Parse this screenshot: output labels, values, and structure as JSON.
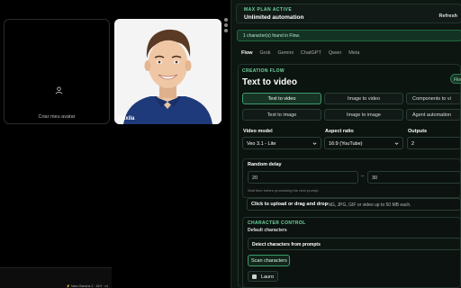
{
  "gallery": {
    "avatar_label": "Criar meu avatar",
    "person_name": "Xinxila",
    "bottom_meta": "⚡ Nano Banana 2 · 16:9 · x4"
  },
  "plan": {
    "tag": "MAX PLAN ACTIVE",
    "title": "Unlimited automation",
    "refresh": "Refresh"
  },
  "found": "1 character(s) found in Flow.",
  "tabs": [
    "Flow",
    "Grok",
    "Gemini",
    "ChatGPT",
    "Qwen",
    "Meta"
  ],
  "flow": {
    "tag": "CREATION FLOW",
    "title": "Text to video",
    "pill": "Flow",
    "modes": [
      "Text to video",
      "Image to video",
      "Components to vi",
      "Text to image",
      "Image to image",
      "Agent automation"
    ]
  },
  "fields": {
    "video_model_label": "Video model",
    "video_model": "Veo 3.1 - Lite",
    "aspect_label": "Aspect ratio",
    "aspect": "16:9 (YouTube)",
    "outputs_label": "Outputs",
    "outputs": "2"
  },
  "delay": {
    "label": "Random delay",
    "min": "20",
    "sep": "–",
    "max": "30",
    "hint": "Wait time before processing the next prompt."
  },
  "upload": {
    "strong": "Click to upload or drag and drop",
    "rest": "PNG, JPG, GIF or video up to 50 MB each."
  },
  "character": {
    "tag": "CHARACTER CONTROL",
    "sub": "Default characters",
    "detect": "Detect characters from prompts",
    "scan": "Scan characters",
    "chip": "Lauro"
  },
  "colors": {
    "accent": "#6fd8a0",
    "panel_bg": "#0e1612",
    "active_border": "#3b9c6a"
  }
}
